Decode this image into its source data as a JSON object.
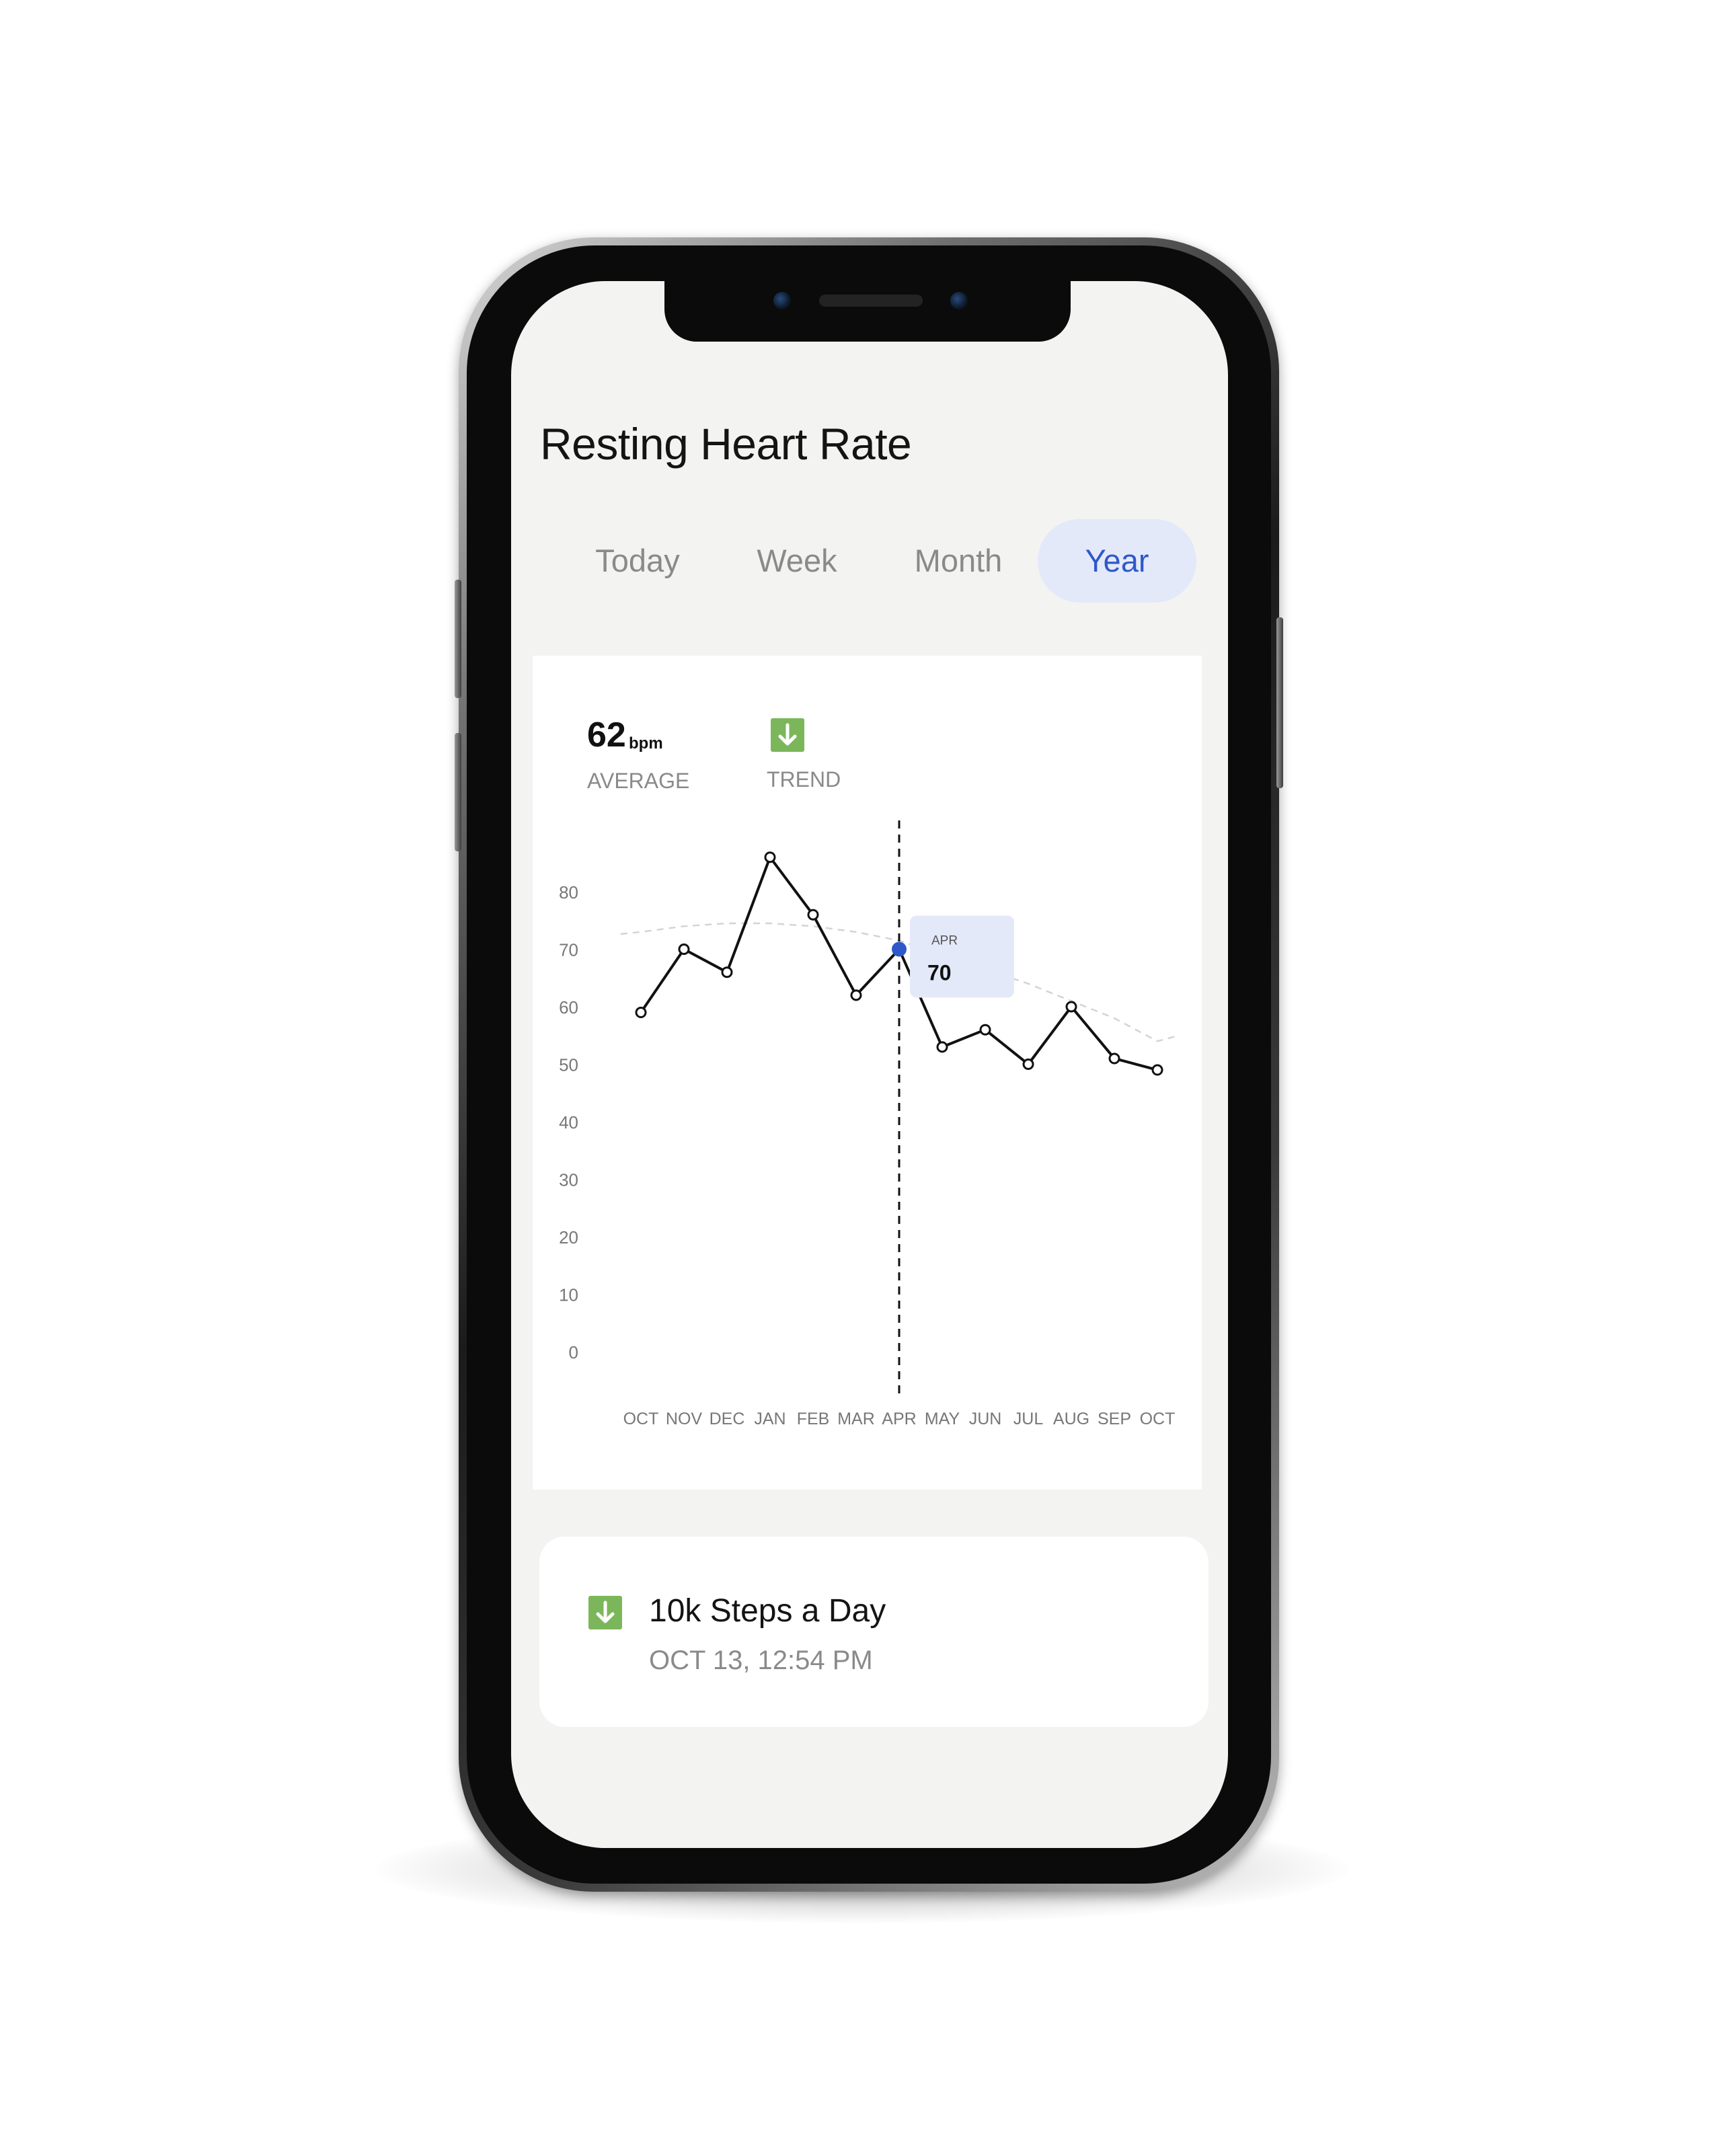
{
  "screen": {
    "title": "Resting Heart Rate"
  },
  "tabs": [
    {
      "label": "Today",
      "active": false
    },
    {
      "label": "Week",
      "active": false
    },
    {
      "label": "Month",
      "active": false
    },
    {
      "label": "Year",
      "active": true
    }
  ],
  "summary": {
    "average_value": "62",
    "average_unit": "bpm",
    "average_label": "AVERAGE",
    "trend_label": "TREND",
    "trend_icon": "arrow-down-icon"
  },
  "tooltip": {
    "month": "APR",
    "value": "70"
  },
  "chart_data": {
    "type": "line",
    "categories": [
      "OCT",
      "NOV",
      "DEC",
      "JAN",
      "FEB",
      "MAR",
      "APR",
      "MAY",
      "JUN",
      "JUL",
      "AUG",
      "SEP",
      "OCT"
    ],
    "series": [
      {
        "values": [
          59,
          70,
          66,
          86,
          76,
          62,
          70,
          53,
          56,
          50,
          60,
          51,
          49
        ]
      }
    ],
    "trend_line": {
      "style": "dashed",
      "values": [
        73,
        74,
        74.5,
        74.5,
        74,
        73,
        71.5,
        69,
        66.5,
        64,
        61,
        58,
        54
      ]
    },
    "highlight": {
      "category_index": 6,
      "value": 70
    },
    "yticks": [
      0,
      10,
      20,
      30,
      40,
      50,
      60,
      70,
      80
    ],
    "ylim": [
      0,
      90
    ],
    "title": "",
    "xlabel": "",
    "ylabel": "",
    "grid": false,
    "colors": {
      "line": "#111111",
      "trend": "#d4d4d4",
      "highlight": "#2f59c9",
      "tooltip_bg": "#e4e9f9"
    }
  },
  "goal": {
    "title": "10k Steps a Day",
    "date": "OCT 13,  12:54 PM",
    "icon": "arrow-down-icon"
  },
  "colors": {
    "accent": "#2f59c9",
    "tab_active_bg": "#e4e9f9",
    "trend_green": "#7bb75a",
    "screen_bg": "#f3f3f2"
  }
}
